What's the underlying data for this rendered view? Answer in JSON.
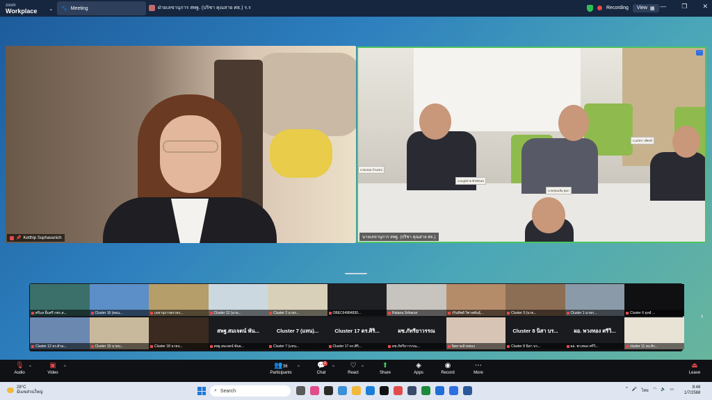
{
  "window": {
    "brand_small": "zoom",
    "brand_big": "Workplace",
    "tab_label": "Meeting",
    "meeting_title": "ฝ่ายเลขานุการ สพฐ. (ปริชา คุณสาย ศธ.) ร.ร",
    "recording": "Recording",
    "view": "View",
    "controls": [
      "—",
      "❐",
      "✕"
    ]
  },
  "videos": {
    "left_name": "Ketthip Suphavanich",
    "right_name": "นายเลขานุการ สพฐ. (ปริชา คุณสาย ศธ.)",
    "right_placards": [
      "นายเกษม ถ้วนรอบ",
      "นายภูมิชาย ฟ้าทักษอร",
      "นายสุขเฉลิม ทุมก",
      "บ.อภัสรา เพียรดี"
    ]
  },
  "gallery": [
    {
      "label": "ศรีแส อิ้มศรี กพร.ส...",
      "big": "",
      "color": "#3b6f6a"
    },
    {
      "label": "Cluster 16 (ตอน...",
      "big": "",
      "color": "#5c8fc7"
    },
    {
      "label": "เลขานุการตรวจร...",
      "big": "",
      "color": "#b59e6a"
    },
    {
      "label": "Cluster 12 (นาย...",
      "big": "",
      "color": "#cbd8e0"
    },
    {
      "label": "Cluster 2 นายร...",
      "big": "",
      "color": "#d8d0b8"
    },
    {
      "label": "OBEC64984830...",
      "big": "",
      "color": "#1f2024"
    },
    {
      "label": "Ratana Sriharun",
      "big": "",
      "color": "#c7c3be"
    },
    {
      "label": "วรินทิพย์ วิศาลพันธุ์...",
      "big": "",
      "color": "#b58c6a"
    },
    {
      "label": "Cluster 3 (นาย...",
      "big": "",
      "color": "#8c6e55"
    },
    {
      "label": "Cluster 1 นายก...",
      "big": "",
      "color": "#8a9aa8"
    },
    {
      "label": "Cluster 6 ยุทธ์ ...",
      "big": "",
      "color": "#101012"
    },
    {
      "label": "Cluster 12 จร.ตัวม...",
      "big": "",
      "color": "#6b88b0"
    },
    {
      "label": "Cluster 15 นายบ...",
      "big": "",
      "color": "#c9b99c"
    },
    {
      "label": "Cluster 18 นายบ...",
      "big": "",
      "color": "#3a2a20"
    },
    {
      "label": "สพฐ.สมเจตน์ พันธ...",
      "big": "สพฐ.สมเจตน์ พัน...",
      "color": "#1a1b1f"
    },
    {
      "label": "Cluster 7 (แทน...",
      "big": "Cluster 7 (แทน)...",
      "color": "#1a1b1f"
    },
    {
      "label": "Cluster 17 ดร.ศิริ...",
      "big": "Cluster 17 ดร.ศิริ...",
      "color": "#1a1b1f"
    },
    {
      "label": "ผช.ภัทรียาวรรณ...",
      "big": "ผช.ภัทรียาวรรณ",
      "color": "#1a1b1f"
    },
    {
      "label": "นิตยาคล้ายชอง",
      "big": "",
      "color": "#d8c4b4"
    },
    {
      "label": "Cluster 8 นิสา บร...",
      "big": "Cluster 8 นิสา บร...",
      "color": "#1a1b1f"
    },
    {
      "label": "ผอ. พวงทอง ศรีวิ...",
      "big": "ผอ. พวงทอง ศรีวิ...",
      "color": "#1a1b1f"
    },
    {
      "label": "cluster 11 สง.ศัก...",
      "big": "",
      "color": "#e9e3d6"
    }
  ],
  "toolbar": {
    "audio": "Audio",
    "video": "Video",
    "participants": "Participants",
    "participants_count": "36",
    "chat": "Chat",
    "chat_badge": "1",
    "react": "React",
    "share": "Share",
    "apps": "Apps",
    "record": "Record",
    "more": "More",
    "leave": "Leave"
  },
  "taskbar": {
    "temp": "28°C",
    "weather": "มีเมฆส่วนใหญ่",
    "search": "Search",
    "lang": "ไทย",
    "time": "8:48",
    "date": "1/7/2568"
  }
}
